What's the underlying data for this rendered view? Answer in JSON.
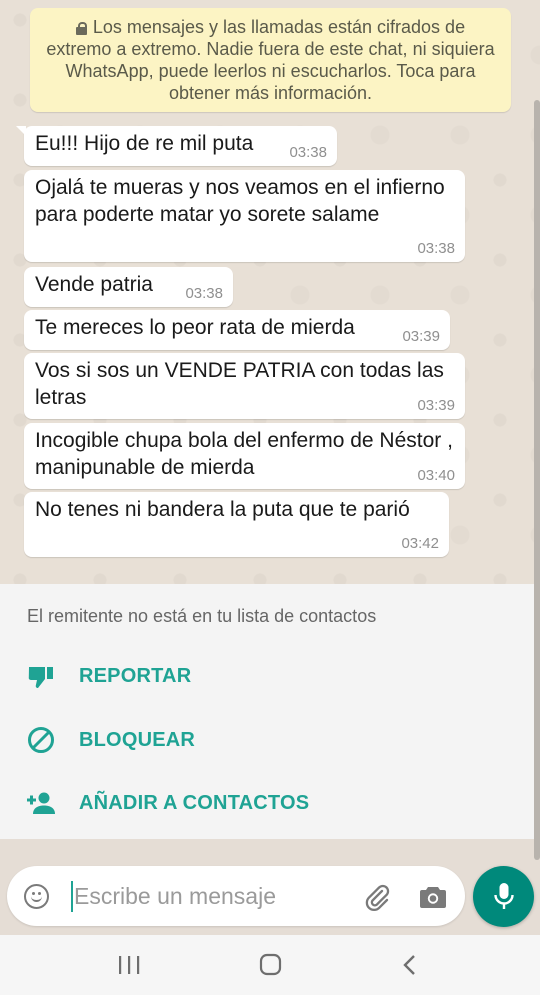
{
  "encryption_notice": "Los mensajes y las llamadas están cifrados de extremo a extremo. Nadie fuera de este chat, ni siquiera WhatsApp, puede leerlos ni escucharlos. Toca para obtener más información.",
  "messages": [
    {
      "text": "Eu!!! Hijo de re mil puta",
      "time": "03:38"
    },
    {
      "text": "Ojalá te mueras y nos veamos en el infierno para poderte matar yo sorete salame",
      "time": "03:38"
    },
    {
      "text": "Vende patria",
      "time": "03:38"
    },
    {
      "text": "Te mereces lo peor rata de mierda",
      "time": "03:39"
    },
    {
      "text": "Vos si sos un VENDE PATRIA con todas las letras",
      "time": "03:39"
    },
    {
      "text": "Incogible chupa bola del enfermo de Néstor , manipunable de mierda",
      "time": "03:40"
    },
    {
      "text": "No tenes ni bandera la puta que te parió",
      "time": "03:42"
    }
  ],
  "unknown_sender": {
    "notice": "El remitente no está en tu lista de contactos",
    "report_label": "REPORTAR",
    "block_label": "BLOQUEAR",
    "add_contact_label": "AÑADIR A CONTACTOS"
  },
  "composer": {
    "placeholder": "Escribe un mensaje"
  },
  "icons": {
    "encryption": "lock-icon",
    "report": "thumbs-down-icon",
    "block": "block-icon",
    "add_contact": "person-add-icon",
    "emoji": "emoji-icon",
    "attach": "paperclip-icon",
    "camera": "camera-icon",
    "mic": "microphone-icon",
    "nav_recents": "recents-icon",
    "nav_home": "home-icon",
    "nav_back": "back-icon"
  },
  "colors": {
    "accent": "#1fa394",
    "mic_button": "#00897b",
    "notice_bg": "#fcf4c4",
    "bubble_bg": "#ffffff"
  }
}
